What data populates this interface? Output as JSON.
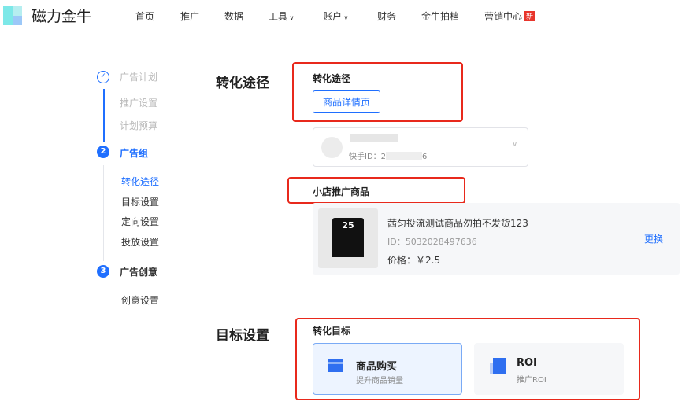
{
  "header": {
    "logo": "磁力金牛",
    "nav": [
      {
        "label": "首页"
      },
      {
        "label": "推广"
      },
      {
        "label": "数据"
      },
      {
        "label": "工具",
        "dropdown": true
      },
      {
        "label": "账户",
        "dropdown": true
      },
      {
        "label": "财务"
      },
      {
        "label": "金牛拍档"
      },
      {
        "label": "营销中心",
        "badge": "新"
      }
    ]
  },
  "steps": {
    "s1": {
      "label": "广告计划",
      "subs": [
        "推广设置",
        "计划预算"
      ]
    },
    "s2": {
      "num": "2",
      "label": "广告组",
      "subs": [
        "转化途径",
        "目标设置",
        "定向设置",
        "投放设置"
      ]
    },
    "s3": {
      "num": "3",
      "label": "广告创意",
      "subs": [
        "创意设置"
      ]
    }
  },
  "conversion": {
    "section_title": "转化途径",
    "label": "转化途径",
    "button": "商品详情页",
    "account": {
      "id_prefix": "快手ID：2",
      "id_suffix": "6"
    }
  },
  "product": {
    "label": "小店推广商品",
    "name": "茜匀投流测试商品勿拍不发货123",
    "id": "ID：5032028497636",
    "price": "价格：￥2.5",
    "change": "更换",
    "image_text": "25"
  },
  "goal": {
    "section_title": "目标设置",
    "label": "转化目标",
    "options": [
      {
        "title": "商品购买",
        "subtitle": "提升商品销量",
        "selected": true
      },
      {
        "title": "ROI",
        "subtitle": "推广ROI",
        "selected": false
      }
    ]
  },
  "colors": {
    "accent": "#1f6fff",
    "highlight": "#e8291c"
  }
}
